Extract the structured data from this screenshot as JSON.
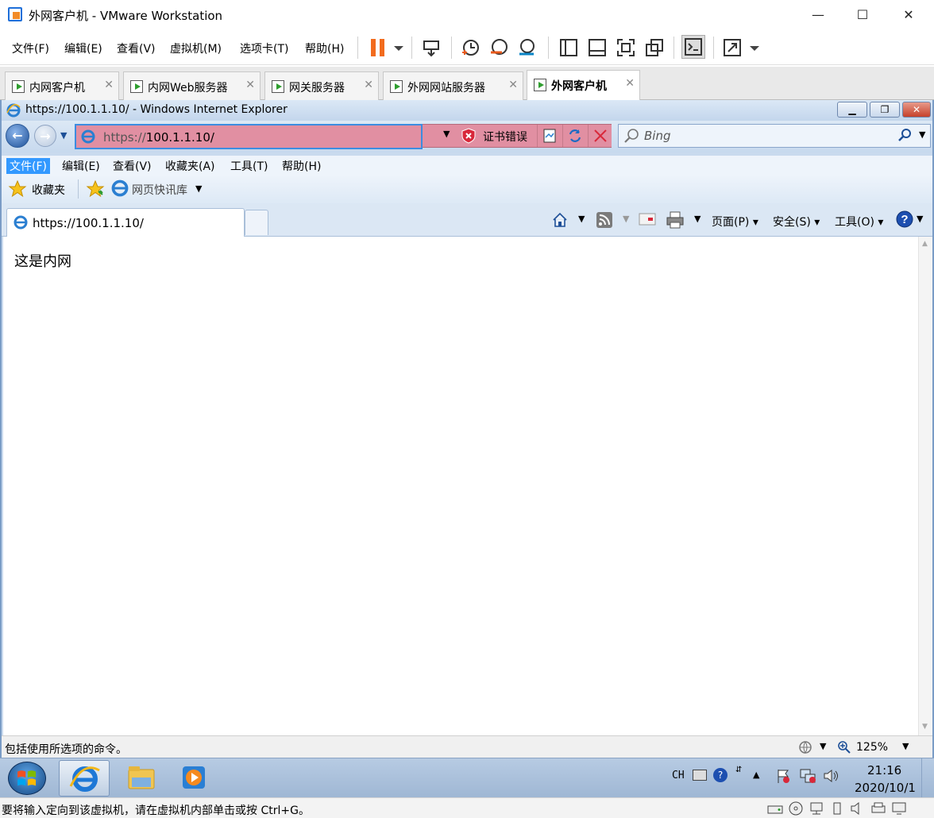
{
  "vmware": {
    "window_title": "外网客户机 - VMware Workstation",
    "menu": [
      "文件(F)",
      "编辑(E)",
      "查看(V)",
      "虚拟机(M)",
      "选项卡(T)",
      "帮助(H)"
    ],
    "tabs": [
      {
        "label": "内网客户机",
        "active": false
      },
      {
        "label": "内网Web服务器",
        "active": false
      },
      {
        "label": "网关服务器",
        "active": false
      },
      {
        "label": "外网网站服务器",
        "active": false
      },
      {
        "label": "外网客户机",
        "active": true
      }
    ],
    "status_text": "要将输入定向到该虚拟机，请在虚拟机内部单击或按 Ctrl+G。"
  },
  "ie": {
    "window_title": "https://100.1.1.10/ - Windows Internet Explorer",
    "address_prefix": "https://",
    "address_host": "100.1.1.10/",
    "cert_error": "证书错误",
    "search_placeholder": "Bing",
    "menu": [
      "文件(F)",
      "编辑(E)",
      "查看(V)",
      "收藏夹(A)",
      "工具(T)",
      "帮助(H)"
    ],
    "favorites_label": "收藏夹",
    "web_slice_label": "网页快讯库",
    "tab_title": "https://100.1.1.10/",
    "commands": {
      "page": "页面(P)",
      "safety": "安全(S)",
      "tools": "工具(O)"
    },
    "content_text": "这是内网",
    "status_text": "包括使用所选项的命令。",
    "zoom": "125%"
  },
  "taskbar": {
    "lang": "CH",
    "time": "21:16",
    "date": "2020/10/1"
  },
  "colors": {
    "address_error_bg": "#e18fa2",
    "address_focus_border": "#3d8ce0",
    "menu_selected": "#3399ff"
  }
}
